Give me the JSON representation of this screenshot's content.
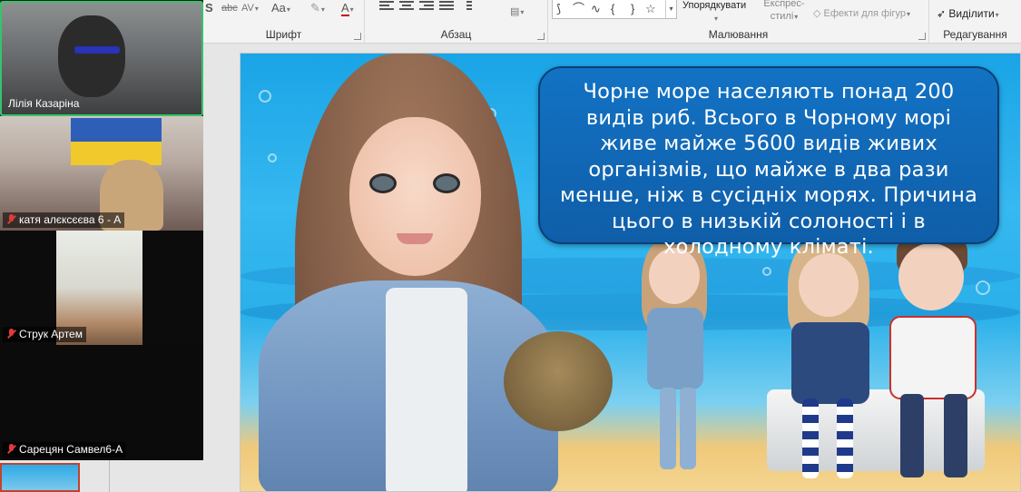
{
  "ribbon": {
    "font_group_label": "Шрифт",
    "paragraph_group_label": "Абзац",
    "drawing_group_label": "Малювання",
    "editing_group_label": "Редагування",
    "strike_label": "abc",
    "spacing_label": "AV",
    "case_label": "Aa",
    "font_color_label": "A",
    "arrange_label": "Упорядкувати",
    "quick_styles_label": "Експрес-стилі",
    "shape_effects_label": "Ефекти для фігур",
    "select_label": "Виділити",
    "shape_glyphs": [
      "⟆",
      "⌒",
      "∿",
      "{",
      "}",
      "☆"
    ]
  },
  "call": {
    "participants": [
      {
        "name": "Лілія Казаріна",
        "muted": false,
        "active": true
      },
      {
        "name": "катя алєксєєва 6 - А",
        "muted": true,
        "active": false
      },
      {
        "name": "Струк Артем",
        "muted": true,
        "active": false
      },
      {
        "name": "Сарецян Самвел6-А",
        "muted": true,
        "active": false
      }
    ]
  },
  "slide": {
    "text": "Чорне море населяють понад 200 видів риб. Всього в Чорному морі живе майже 5600 видів живих організмів, що майже в два рази менше, ніж в сусідніх морях. Причина цього в низькій солоності і в холодному кліматі.",
    "textbox_color": "#1372c4"
  }
}
